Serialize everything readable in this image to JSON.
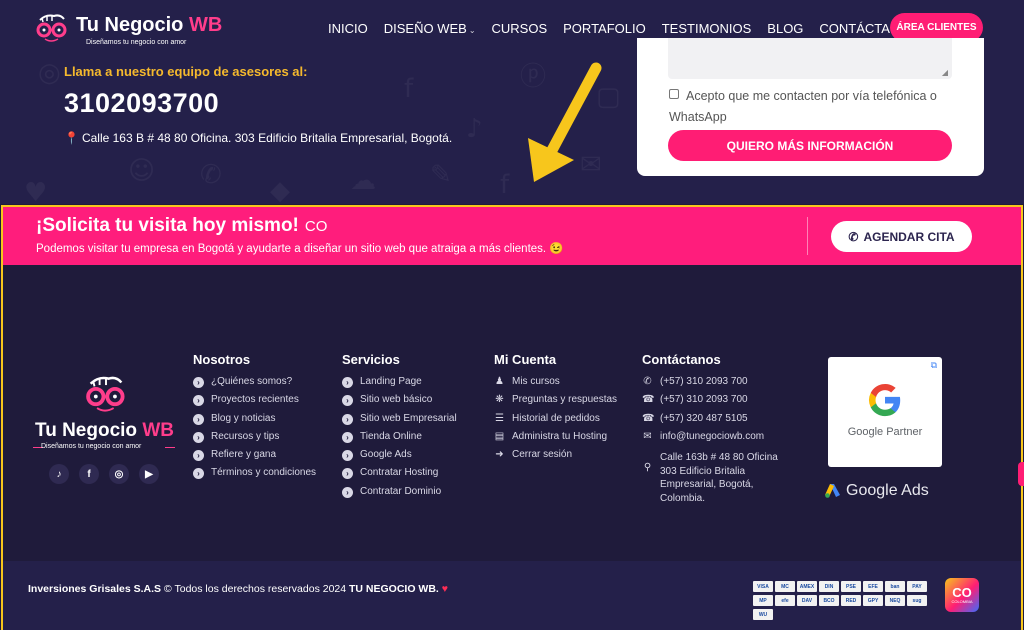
{
  "brand": {
    "name_main": "Tu Negocio ",
    "name_accent": "WB",
    "tagline": "Diseñamos tu negocio con amor"
  },
  "nav": {
    "items": [
      {
        "label": "INICIO"
      },
      {
        "label": "DISEÑO WEB",
        "has_dropdown": true
      },
      {
        "label": "CURSOS"
      },
      {
        "label": "PORTAFOLIO"
      },
      {
        "label": "TESTIMONIOS"
      },
      {
        "label": "BLOG"
      },
      {
        "label": "CONTÁCTANOS"
      }
    ],
    "area_button": "ÁREA CLIENTES"
  },
  "hero": {
    "call_label": "Llama a nuestro equipo de asesores al:",
    "phone": "3102093700",
    "address": "Calle 163 B # 48 80 Oficina. 303 Edificio Britalia Empresarial, Bogotá."
  },
  "form": {
    "consent": "Acepto que me contacten por vía telefónica o WhatsApp",
    "submit": "QUIERO MÁS INFORMACIÓN"
  },
  "cta": {
    "title": "¡Solicita tu visita hoy mismo!",
    "country_code": "CO",
    "subtitle": "Podemos visitar tu empresa en Bogotá y ayudarte a diseñar un sitio web que atraiga a más clientes. 😉",
    "button": "AGENDAR CITA"
  },
  "footer": {
    "socials": [
      {
        "icon": "tiktok-icon",
        "glyph": "♪"
      },
      {
        "icon": "facebook-icon",
        "glyph": "f"
      },
      {
        "icon": "instagram-icon",
        "glyph": "◎"
      },
      {
        "icon": "youtube-icon",
        "glyph": "▶"
      }
    ],
    "nosotros": {
      "title": "Nosotros",
      "items": [
        "¿Quiénes somos?",
        "Proyectos recientes",
        "Blog y noticias",
        "Recursos y tips",
        "Refiere y gana",
        "Términos y condiciones"
      ]
    },
    "servicios": {
      "title": "Servicios",
      "items": [
        "Landing Page",
        "Sitio web básico",
        "Sitio web Empresarial",
        "Tienda Online",
        "Google Ads",
        "Contratar Hosting",
        "Contratar Dominio"
      ]
    },
    "cuenta": {
      "title": "Mi Cuenta",
      "items": [
        {
          "label": "Mis cursos",
          "icon": "user-graduate-icon",
          "glyph": "♟"
        },
        {
          "label": "Preguntas y respuestas",
          "icon": "brain-icon",
          "glyph": "❋"
        },
        {
          "label": "Historial de pedidos",
          "icon": "history-icon",
          "glyph": "☰"
        },
        {
          "label": "Administra tu Hosting",
          "icon": "server-icon",
          "glyph": "▤"
        },
        {
          "label": "Cerrar sesión",
          "icon": "sign-out-icon",
          "glyph": "➜"
        }
      ]
    },
    "contacto": {
      "title": "Contáctanos",
      "items": [
        {
          "label": "(+57) 310 2093 700",
          "icon": "whatsapp-icon",
          "glyph": "✆"
        },
        {
          "label": "(+57) 310 2093 700",
          "icon": "phone-icon",
          "glyph": "☎"
        },
        {
          "label": "(+57) 320 487 5105",
          "icon": "phone-icon",
          "glyph": "☎"
        },
        {
          "label": "info@tunegociowb.com",
          "icon": "envelope-icon",
          "glyph": "✉"
        },
        {
          "label": "Calle 163b # 48 80 Oficina 303 Edificio Britalia Empresarial, Bogotá, Colombia.",
          "icon": "map-marker-icon",
          "glyph": "⚲",
          "multi": true
        }
      ]
    },
    "google_partner": "Google Partner",
    "google_ads": "Google Ads"
  },
  "bottom": {
    "company": "Inversiones Grisales S.A.S",
    "copyright": "Todos los derechos reservados 2024",
    "brand_caps": "TU NEGOCIO WB.",
    "payments": [
      "VISA",
      "MC",
      "AMEX",
      "DIN",
      "PSE",
      "EFE",
      "ban",
      "PAY",
      "MP",
      "efe",
      "DAV",
      "BCO",
      "RED",
      "GPY",
      "NEQ",
      "sug",
      "WU"
    ],
    "colombia_badge": "CO",
    "colombia_badge_sub": "COLOMBIA"
  },
  "colors": {
    "accent_pink": "#ff1d74",
    "accent_yellow": "#f5b92d",
    "frame_yellow": "#f7c61c",
    "dark_bg": "#1f1b3b",
    "hero_bg": "#24204a"
  }
}
